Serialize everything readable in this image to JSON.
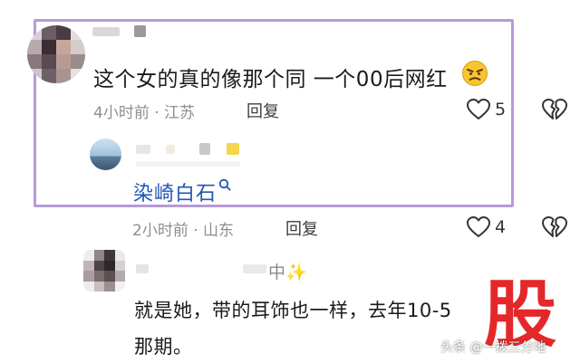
{
  "comments": [
    {
      "text": "这个女的真的像那个同 一个00后网红",
      "emoji": "😠",
      "meta": "4小时前 · 江苏",
      "reply_label": "回复",
      "likes": "5"
    },
    {
      "text": "染崎白石",
      "meta": "2小时前 · 山东",
      "reply_label": "回复",
      "likes": "4"
    },
    {
      "name_suffix": "中✨",
      "text_line1": "就是她，带的耳饰也一样，去年10-5",
      "text_line2": "那期。"
    }
  ],
  "colors": {
    "highlight_border": "#b79ad8",
    "link_blue": "#1f56b5",
    "stamp_red": "#e4282a"
  },
  "icons": [
    "heart-icon",
    "broken-heart-icon",
    "search-icon",
    "angry-face-icon"
  ],
  "watermark": {
    "text": "头条 @一拨三分地",
    "stamp_char": "股"
  }
}
